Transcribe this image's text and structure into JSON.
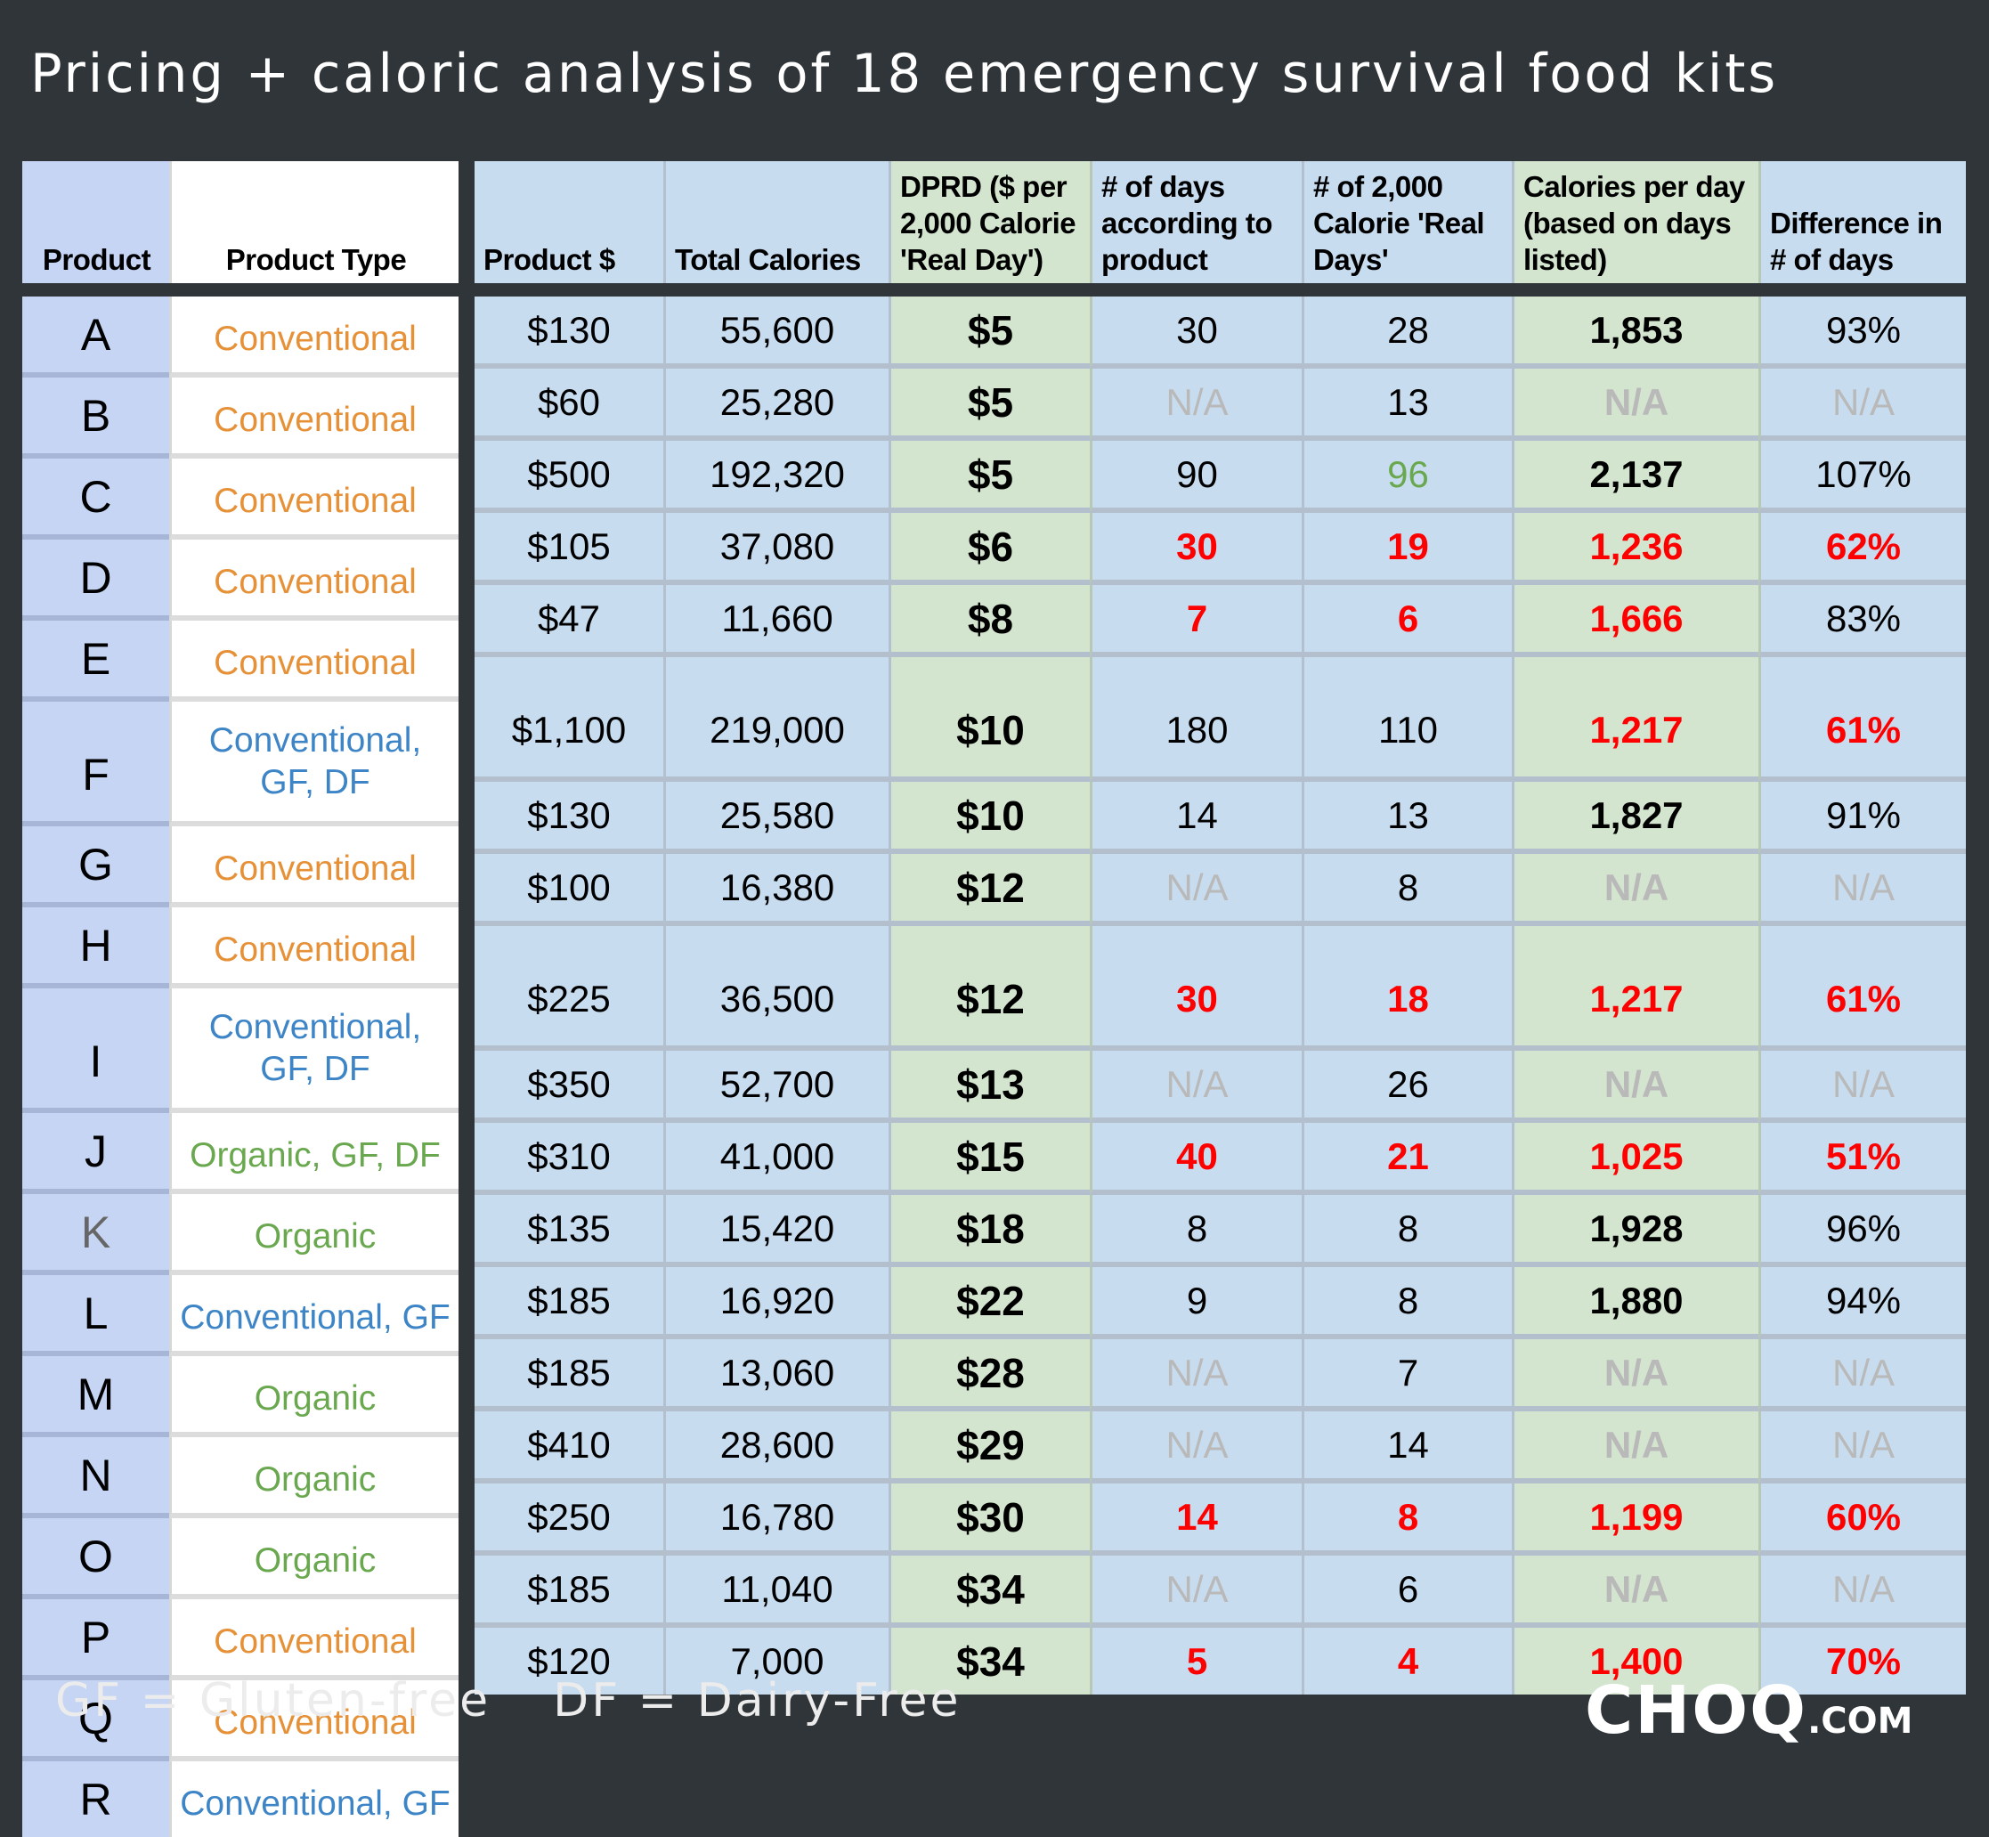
{
  "title": "Pricing + caloric analysis of 18 emergency survival food kits",
  "colors": {
    "conventional": "#e69138",
    "conventional_gf_df": "#3d85c6",
    "organic": "#6aa84f",
    "warning": "#ff0000",
    "na": "#b9b9b9",
    "good": "#6aa84f"
  },
  "headers": {
    "product": "Product",
    "product_type": "Product Type",
    "product_price": "Product $",
    "total_calories": "Total Calories",
    "dprd": "DPRD ($ per 2,000 Calorie 'Real Day')",
    "days_claimed": "# of days according to product",
    "real_days": "# of 2,000 Calorie 'Real Days'",
    "cal_per_day": "Calories per day (based on days listed)",
    "diff_days": "Difference in # of days"
  },
  "rows": [
    {
      "product": "A",
      "type": "Conventional",
      "type_class": "conventional",
      "price": "$130",
      "calories": "55,600",
      "dprd": "$5",
      "days": "30",
      "real_days": "28",
      "cal_day": "1,853",
      "diff": "93%",
      "flag": ""
    },
    {
      "product": "B",
      "type": "Conventional",
      "type_class": "conventional",
      "price": "$60",
      "calories": "25,280",
      "dprd": "$5",
      "days": "N/A",
      "real_days": "13",
      "cal_day": "N/A",
      "diff": "N/A",
      "flag": "na"
    },
    {
      "product": "C",
      "type": "Conventional",
      "type_class": "conventional",
      "price": "$500",
      "calories": "192,320",
      "dprd": "$5",
      "days": "90",
      "real_days": "96",
      "cal_day": "2,137",
      "diff": "107%",
      "flag": "good"
    },
    {
      "product": "D",
      "type": "Conventional",
      "type_class": "conventional",
      "price": "$105",
      "calories": "37,080",
      "dprd": "$6",
      "days": "30",
      "real_days": "19",
      "cal_day": "1,236",
      "diff": "62%",
      "flag": "red_all"
    },
    {
      "product": "E",
      "type": "Conventional",
      "type_class": "conventional",
      "price": "$47",
      "calories": "11,660",
      "dprd": "$8",
      "days": "7",
      "real_days": "6",
      "cal_day": "1,666",
      "diff": "83%",
      "flag": "red_partial"
    },
    {
      "product": "F",
      "type": "Conventional, GF, DF",
      "type_class": "gfdf",
      "price": "$1,100",
      "calories": "219,000",
      "dprd": "$10",
      "days": "180",
      "real_days": "110",
      "cal_day": "1,217",
      "diff": "61%",
      "flag": "red_calpct"
    },
    {
      "product": "G",
      "type": "Conventional",
      "type_class": "conventional",
      "price": "$130",
      "calories": "25,580",
      "dprd": "$10",
      "days": "14",
      "real_days": "13",
      "cal_day": "1,827",
      "diff": "91%",
      "flag": ""
    },
    {
      "product": "H",
      "type": "Conventional",
      "type_class": "conventional",
      "price": "$100",
      "calories": "16,380",
      "dprd": "$12",
      "days": "N/A",
      "real_days": "8",
      "cal_day": "N/A",
      "diff": "N/A",
      "flag": "na"
    },
    {
      "product": "I",
      "type": "Conventional, GF, DF",
      "type_class": "gfdf",
      "price": "$225",
      "calories": "36,500",
      "dprd": "$12",
      "days": "30",
      "real_days": "18",
      "cal_day": "1,217",
      "diff": "61%",
      "flag": "red_all"
    },
    {
      "product": "J",
      "type": "Organic, GF, DF",
      "type_class": "organic",
      "price": "$350",
      "calories": "52,700",
      "dprd": "$13",
      "days": "N/A",
      "real_days": "26",
      "cal_day": "N/A",
      "diff": "N/A",
      "flag": "na"
    },
    {
      "product": "K",
      "type": "Organic",
      "type_class": "organic",
      "price": "$310",
      "calories": "41,000",
      "dprd": "$15",
      "days": "40",
      "real_days": "21",
      "cal_day": "1,025",
      "diff": "51%",
      "flag": "red_all"
    },
    {
      "product": "L",
      "type": "Conventional, GF",
      "type_class": "gfdf",
      "price": "$135",
      "calories": "15,420",
      "dprd": "$18",
      "days": "8",
      "real_days": "8",
      "cal_day": "1,928",
      "diff": "96%",
      "flag": ""
    },
    {
      "product": "M",
      "type": "Organic",
      "type_class": "organic",
      "price": "$185",
      "calories": "16,920",
      "dprd": "$22",
      "days": "9",
      "real_days": "8",
      "cal_day": "1,880",
      "diff": "94%",
      "flag": ""
    },
    {
      "product": "N",
      "type": "Organic",
      "type_class": "organic",
      "price": "$185",
      "calories": "13,060",
      "dprd": "$28",
      "days": "N/A",
      "real_days": "7",
      "cal_day": "N/A",
      "diff": "N/A",
      "flag": "na"
    },
    {
      "product": "O",
      "type": "Organic",
      "type_class": "organic",
      "price": "$410",
      "calories": "28,600",
      "dprd": "$29",
      "days": "N/A",
      "real_days": "14",
      "cal_day": "N/A",
      "diff": "N/A",
      "flag": "na"
    },
    {
      "product": "P",
      "type": "Conventional",
      "type_class": "conventional",
      "price": "$250",
      "calories": "16,780",
      "dprd": "$30",
      "days": "14",
      "real_days": "8",
      "cal_day": "1,199",
      "diff": "60%",
      "flag": "red_all"
    },
    {
      "product": "Q",
      "type": "Conventional",
      "type_class": "conventional",
      "price": "$185",
      "calories": "11,040",
      "dprd": "$34",
      "days": "N/A",
      "real_days": "6",
      "cal_day": "N/A",
      "diff": "N/A",
      "flag": "na"
    },
    {
      "product": "R",
      "type": "Conventional, GF",
      "type_class": "gfdf",
      "price": "$120",
      "calories": "7,000",
      "dprd": "$34",
      "days": "5",
      "real_days": "4",
      "cal_day": "1,400",
      "diff": "70%",
      "flag": "red_all"
    }
  ],
  "footer": {
    "legend_gf": "GF = Gluten-free",
    "legend_df": "DF = Dairy-Free",
    "logo_main": "CHOQ",
    "logo_suffix": ".COM"
  }
}
